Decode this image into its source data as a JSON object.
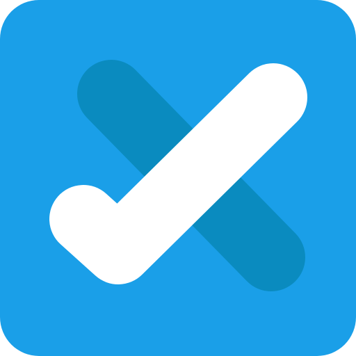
{
  "icon": {
    "name": "check-x-app-icon",
    "colors": {
      "background": "#1A9FE8",
      "cross": "#0A8BBF",
      "check": "#FFFFFF"
    }
  }
}
